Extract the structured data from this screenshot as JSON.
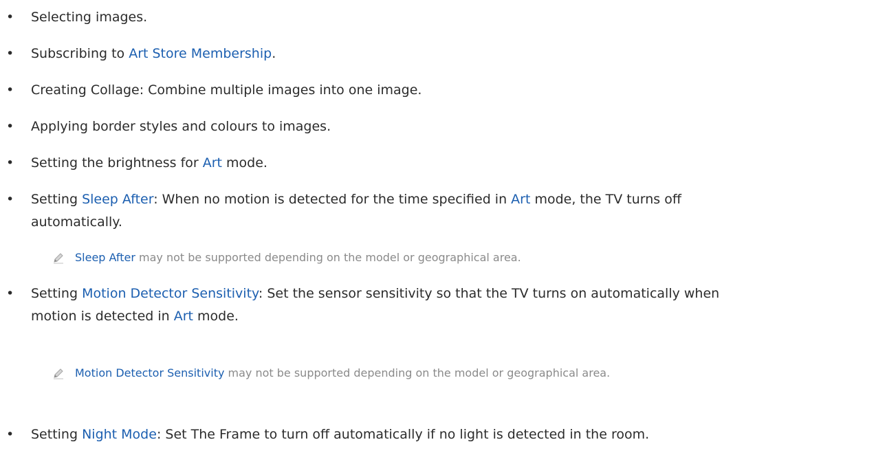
{
  "bullet_glyph": "•",
  "items": [
    {
      "a": "Selecting images."
    },
    {
      "a": "Subscribing to ",
      "link": "Art Store Membership",
      "b": "."
    },
    {
      "a": "Creating Collage: Combine multiple images into one image."
    },
    {
      "a": "Applying border styles and colours to images."
    },
    {
      "a": "Setting the brightness for ",
      "link": "Art",
      "b": " mode."
    },
    {
      "a": "Setting ",
      "link": "Sleep After",
      "b": ": When no motion is detected for the time specified in ",
      "link2": "Art",
      "c": " mode, the TV turns off",
      "line2": "automatically."
    },
    {
      "a": "Setting ",
      "link": "Motion Detector Sensitivity",
      "b": ": Set the sensor sensitivity so that the TV turns on automatically when",
      "line2a": "motion is detected in ",
      "link2": "Art",
      "line2b": " mode."
    },
    {
      "a": "Setting ",
      "link": "Night Mode",
      "b": ": Set The Frame to turn off automatically if no light is detected in the room."
    }
  ],
  "notes": [
    {
      "link": "Sleep After",
      "text": " may not be supported depending on the model or geographical area."
    },
    {
      "link": "Motion Detector Sensitivity",
      "text": " may not be supported depending on the model or geographical area."
    }
  ],
  "icons": {
    "note": "pencil-icon"
  },
  "colors": {
    "link": "#1c5fb0",
    "text": "#2b2b2b",
    "note": "#8a8a8a"
  }
}
